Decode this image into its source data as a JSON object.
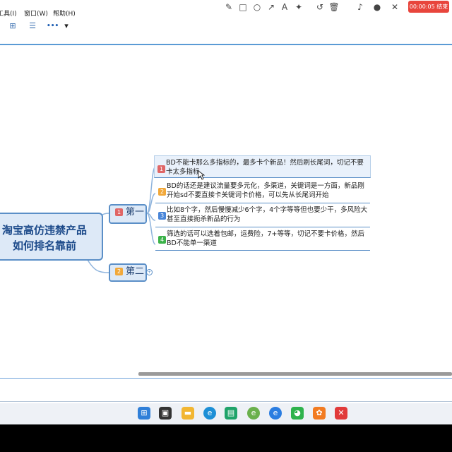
{
  "menu": {
    "tools": "工具(I)",
    "window": "窗口(W)",
    "help": "帮助(H)"
  },
  "recorder": {
    "icons": [
      "pen-icon",
      "rect-icon",
      "circle-icon",
      "arrow-icon",
      "text-icon",
      "highlighter-icon",
      "undo-icon",
      "trash-icon",
      "speaker-icon",
      "mic-icon",
      "close-icon"
    ],
    "timer": "00:00:05 结束"
  },
  "toolbar": {
    "more": "•••",
    "dropdown": "▾"
  },
  "mindmap": {
    "central": "淘宝高仿违禁产品\n如何排名靠前",
    "nodes": [
      {
        "badge": "1",
        "label": "第一"
      },
      {
        "badge": "2",
        "label": "第二"
      }
    ],
    "leaves": [
      {
        "badge": "1",
        "color": "#e06666",
        "text": "BD不能卡那么多指标的，最多卡个新品！然后刷长尾词，切记不要卡太多指标"
      },
      {
        "badge": "2",
        "color": "#f1a83a",
        "text": "BD的话还是建议流量要多元化，多渠道，关键词是一方面，新品刚开始sd不要直接卡关键词卡价格，可以先从长尾词开始"
      },
      {
        "badge": "3",
        "color": "#4a86d8",
        "text": "比如8个字，然后慢慢减少6个字，4个字等等但也要少干，多风险大甚至直接扼杀新品的行为"
      },
      {
        "badge": "4",
        "color": "#3cb34a",
        "text": "筛选的话可以选着包邮，运费险，7+等等，切记不要卡价格，然后BD不能单一渠道"
      }
    ]
  },
  "colors": {
    "accent": "#5b8fc7",
    "timer": "#e8453c"
  }
}
